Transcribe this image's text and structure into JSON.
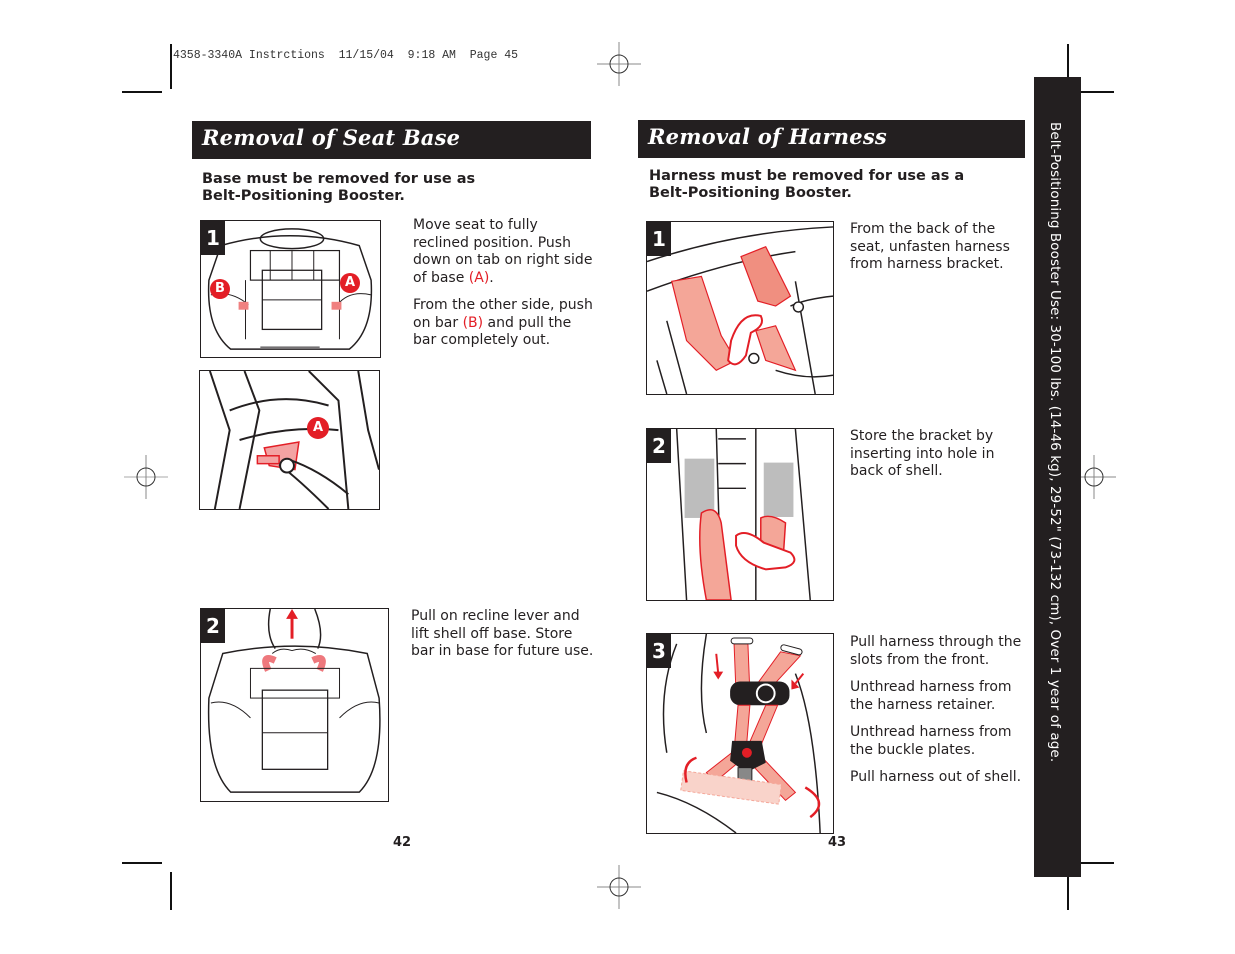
{
  "slug_line": "4358-3340A Instrctions  11/15/04  9:18 AM  Page 45",
  "colors": {
    "ink": "#231f20",
    "accent_red": "#e31e26",
    "harness_pink": "#f4a698"
  },
  "left_page": {
    "title": "Removal of Seat Base",
    "subtitle_line1": "Base must be removed for use as",
    "subtitle_line2": "Belt-Positioning Booster.",
    "page_number": "42",
    "steps": [
      {
        "number": "1",
        "figure_labels": [
          "B",
          "A"
        ],
        "paragraphs": [
          {
            "before": "Move seat to fully reclined position. Push down on tab on right side of base ",
            "highlight": "(A)",
            "after": "."
          },
          {
            "before": "From the other side, push on bar ",
            "highlight": "(B)",
            "after": " and pull the bar completely out."
          }
        ],
        "detail_figure_label": "A"
      },
      {
        "number": "2",
        "paragraphs": [
          {
            "text": "Pull on recline lever and lift shell off base. Store bar in base for future use."
          }
        ]
      }
    ]
  },
  "right_page": {
    "title": "Removal of Harness",
    "subtitle_line1": "Harness must be removed for use as a",
    "subtitle_line2": "Belt-Positioning Booster.",
    "page_number": "43",
    "steps": [
      {
        "number": "1",
        "paragraphs": [
          {
            "text": "From the back of the seat, unfasten harness from harness bracket."
          }
        ]
      },
      {
        "number": "2",
        "paragraphs": [
          {
            "text": "Store the bracket by inserting into hole in back of shell."
          }
        ]
      },
      {
        "number": "3",
        "paragraphs": [
          {
            "text": "Pull harness through the slots from the front."
          },
          {
            "text": "Unthread harness from the harness retainer."
          },
          {
            "text": "Unthread harness from the buckle plates."
          },
          {
            "text": "Pull harness out of shell."
          }
        ]
      }
    ]
  },
  "side_tab": {
    "text": "Belt-Positioning Booster Use: 30-100 lbs. (14-46 kg), 29-52\" (73-132 cm), Over 1 year of age."
  }
}
